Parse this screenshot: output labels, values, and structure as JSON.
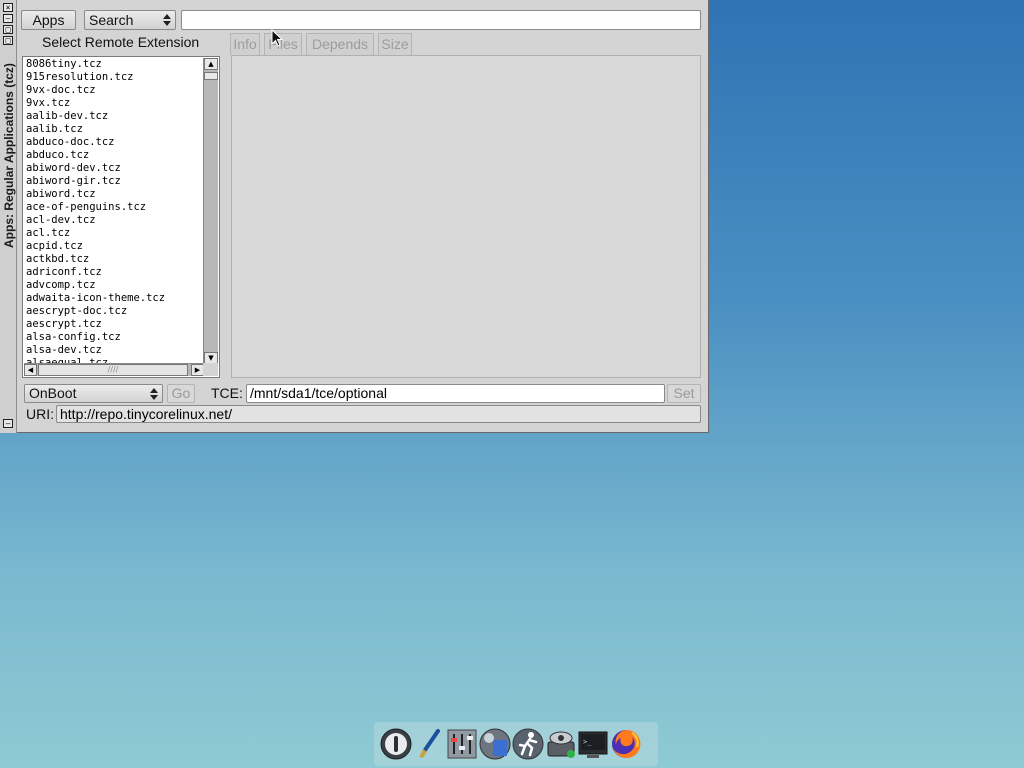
{
  "window": {
    "title": "Apps: Regular Applications (tcz)",
    "title_buttons": [
      "×",
      "–",
      "□",
      "□"
    ]
  },
  "toolbar": {
    "apps_label": "Apps",
    "search_mode": "Search",
    "search_value": ""
  },
  "list_header": "Select Remote Extension",
  "extensions": [
    "8086tiny.tcz",
    "915resolution.tcz",
    "9vx-doc.tcz",
    "9vx.tcz",
    "aalib-dev.tcz",
    "aalib.tcz",
    "abduco-doc.tcz",
    "abduco.tcz",
    "abiword-dev.tcz",
    "abiword-gir.tcz",
    "abiword.tcz",
    "ace-of-penguins.tcz",
    "acl-dev.tcz",
    "acl.tcz",
    "acpid.tcz",
    "actkbd.tcz",
    "adriconf.tcz",
    "advcomp.tcz",
    "adwaita-icon-theme.tcz",
    "aescrypt-doc.tcz",
    "aescrypt.tcz",
    "alsa-config.tcz",
    "alsa-dev.tcz",
    "alsaequal.tcz"
  ],
  "tabs": [
    "Info",
    "Files",
    "Depends",
    "Size"
  ],
  "bottom": {
    "install_mode": "OnBoot",
    "go_label": "Go",
    "tce_label": "TCE:",
    "tce_path": "/mnt/sda1/tce/optional",
    "set_label": "Set",
    "uri_label": "URI:",
    "uri_value": "http://repo.tinycorelinux.net/"
  },
  "dock_icons": [
    "power-icon",
    "paintbrush-icon",
    "control-panel-icon",
    "mount-tool-icon",
    "run-icon",
    "app-browser-icon",
    "terminal-icon",
    "firefox-icon"
  ]
}
